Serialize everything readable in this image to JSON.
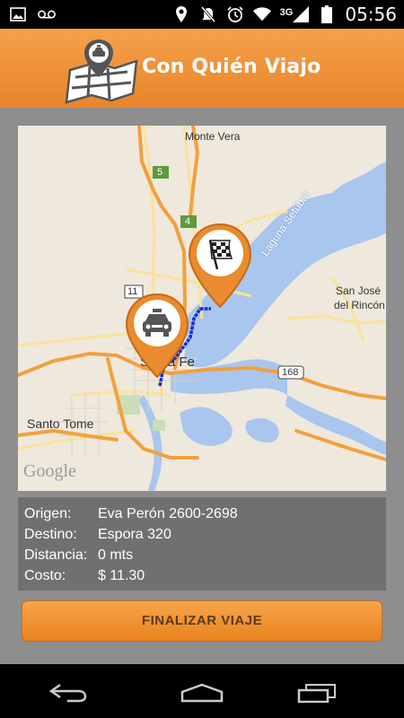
{
  "status_bar": {
    "network": "3G",
    "time": "05:56",
    "icons": [
      "image-icon",
      "voicemail-icon",
      "location-icon",
      "mute-icon",
      "alarm-icon",
      "wifi-icon",
      "signal-icon",
      "battery-icon"
    ]
  },
  "app": {
    "title": "Con Quién Viajo",
    "logo_icon": "taxi-map-logo"
  },
  "map": {
    "labels": {
      "monte_vera": "Monte Vera",
      "road_5": "5",
      "road_4": "4",
      "road_11": "11",
      "road_168": "168",
      "laguna": "Laguna Setúbal",
      "san_jose": "San José",
      "del_rincon": "del Rincón",
      "santa_fe": "Santa Fe",
      "santo_tome": "Santo Tome",
      "google": "Google"
    },
    "markers": [
      "taxi-marker-icon",
      "finish-flag-marker-icon"
    ],
    "colors": {
      "route": "#1a2bd6",
      "water": "#a9c6ee",
      "major_road": "#f2a03c",
      "minor_road": "#fbe29a",
      "land": "#efe8dc"
    }
  },
  "trip": {
    "origin_label": "Origen:",
    "origin_value": "Eva Perón 2600-2698",
    "destination_label": "Destino:",
    "destination_value": "Espora 320",
    "distance_label": "Distancia:",
    "distance_value": "0 mts",
    "cost_label": "Costo:",
    "cost_value": "$ 11.30"
  },
  "actions": {
    "finish_label": "FINALIZAR VIAJE"
  },
  "nav": {
    "back": "back-icon",
    "home": "home-icon",
    "recents": "recents-icon"
  }
}
